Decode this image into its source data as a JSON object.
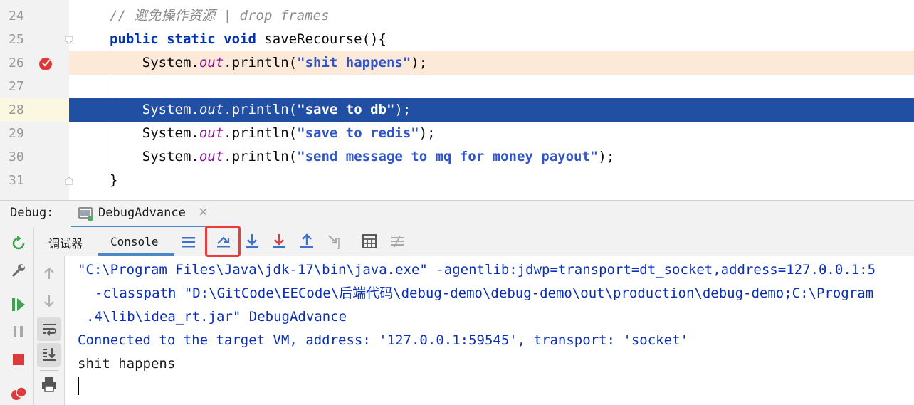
{
  "editor": {
    "lines": [
      {
        "num": "24",
        "parts": [
          {
            "t": "// 避免操作资源 | drop frames",
            "c": "cmt"
          }
        ]
      },
      {
        "num": "25",
        "parts": [
          {
            "t": "public static void ",
            "c": "kw"
          },
          {
            "t": "saveRecourse(){",
            "c": ""
          }
        ]
      },
      {
        "num": "26",
        "parts": [
          {
            "t": "    System.",
            "c": ""
          },
          {
            "t": "out",
            "c": "fld"
          },
          {
            "t": ".println(",
            "c": ""
          },
          {
            "t": "\"shit happens\"",
            "c": "str-blue"
          },
          {
            "t": ");",
            "c": ""
          }
        ]
      },
      {
        "num": "27",
        "parts": []
      },
      {
        "num": "28",
        "parts": [
          {
            "t": "    System.",
            "c": ""
          },
          {
            "t": "out",
            "c": "fld"
          },
          {
            "t": ".println(",
            "c": ""
          },
          {
            "t": "\"save to db\"",
            "c": "str-blue"
          },
          {
            "t": ");",
            "c": ""
          }
        ]
      },
      {
        "num": "29",
        "parts": [
          {
            "t": "    System.",
            "c": ""
          },
          {
            "t": "out",
            "c": "fld"
          },
          {
            "t": ".println(",
            "c": ""
          },
          {
            "t": "\"save to redis\"",
            "c": "str-blue"
          },
          {
            "t": ");",
            "c": ""
          }
        ]
      },
      {
        "num": "30",
        "parts": [
          {
            "t": "    System.",
            "c": ""
          },
          {
            "t": "out",
            "c": "fld"
          },
          {
            "t": ".println(",
            "c": ""
          },
          {
            "t": "\"send message to mq for money payout\"",
            "c": "str-blue"
          },
          {
            "t": ");",
            "c": ""
          }
        ]
      },
      {
        "num": "31",
        "parts": [
          {
            "t": "}",
            "c": ""
          }
        ]
      }
    ],
    "breakpoint_line": "26",
    "current_line": "28"
  },
  "debug": {
    "label": "Debug:",
    "tab_name": "DebugAdvance",
    "close_glyph": "×"
  },
  "tabs": {
    "debugger": "调试器",
    "console": "Console"
  },
  "toolbar_icons": [
    "show-execution-point-icon",
    "step-over-icon",
    "step-into-icon",
    "force-step-into-icon",
    "step-out-icon",
    "run-to-cursor-icon",
    "evaluate-expression-icon",
    "trace-stream-icon"
  ],
  "console": {
    "lines": [
      {
        "text": "\"C:\\Program Files\\Java\\jdk-17\\bin\\java.exe\" -agentlib:jdwp=transport=dt_socket,address=127.0.0.1:5",
        "style": "c-blue",
        "indent": 0
      },
      {
        "text": "-classpath \"D:\\GitCode\\EECode\\后端代码\\debug-demo\\debug-demo\\out\\production\\debug-demo;C:\\Program",
        "style": "c-blue",
        "indent": 24
      },
      {
        "text": ".4\\lib\\idea_rt.jar\" DebugAdvance",
        "style": "c-blue",
        "indent": 12
      },
      {
        "text": "Connected to the target VM, address: '127.0.0.1:59545', transport: 'socket'",
        "style": "c-blue",
        "indent": 0
      },
      {
        "text": "shit happens",
        "style": "c-black",
        "indent": 0
      }
    ]
  },
  "colors": {
    "selection": "#214fa3",
    "breakpoint_line_bg": "#fce9d7",
    "accent": "#4a88c7",
    "highlight_box": "#f03a3a"
  }
}
